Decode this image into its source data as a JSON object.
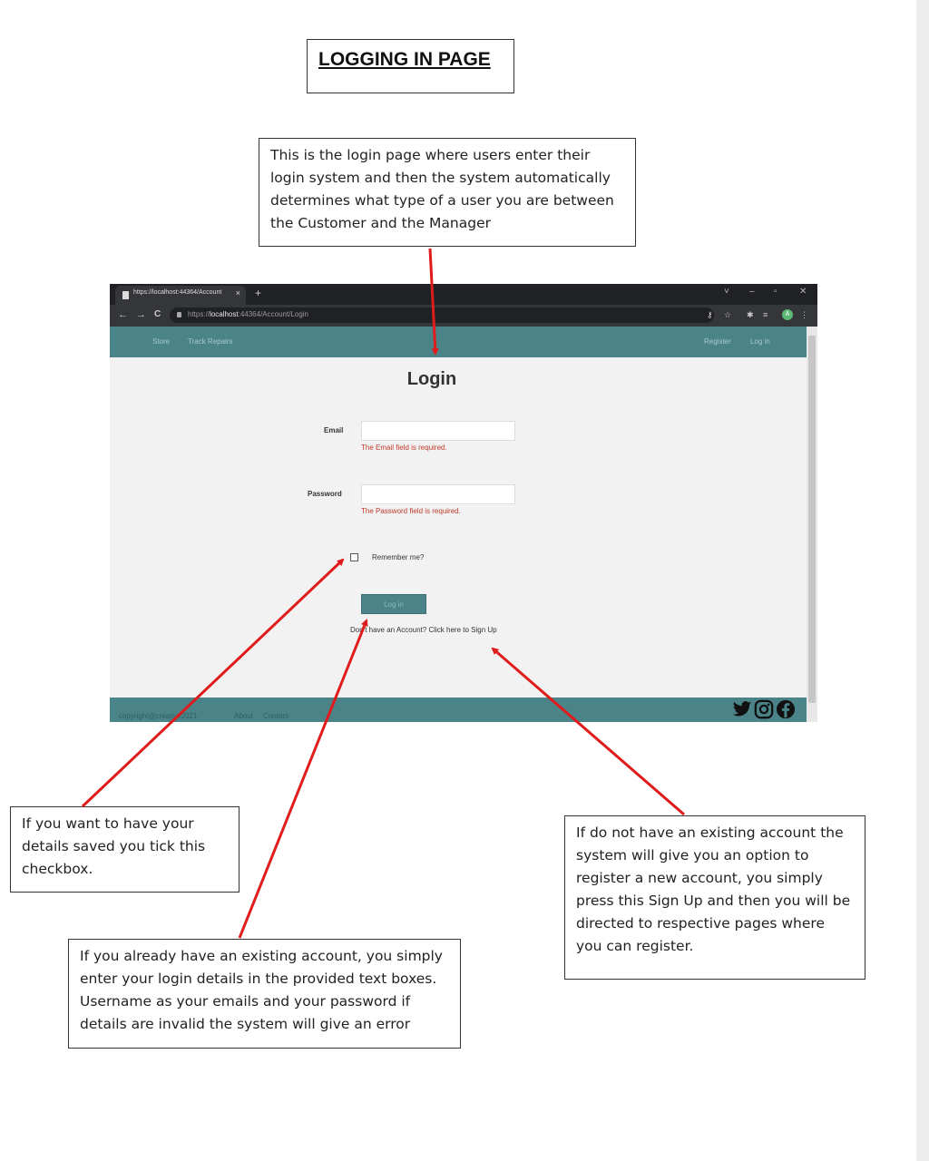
{
  "page": {
    "title": "LOGGING IN PAGE",
    "notes": {
      "login_intro": "This is the login page where users enter their login system and then the system automatically determines what type of a user you are between the Customer and the Manager",
      "checkbox": "If you want to have your details saved you tick this checkbox.",
      "existing_account": "If you already have an existing account, you simply enter your login details in the provided text boxes. Username as your emails and your password if details are invalid the system will give an error",
      "sign_up": "If do not have an existing account the system will give you an option to register a new account, you simply press this Sign Up and then you will be directed to respective pages where you can register."
    }
  },
  "browser": {
    "tab_title": "https://localhost:44364/Account",
    "new_tab": "+",
    "tab_close": "×",
    "url_prefix": "https://",
    "url_host": "localhost",
    "url_rest": ":44364/Account/Login",
    "window_controls": [
      "˅",
      "–",
      "▫",
      "✕"
    ],
    "nav": [
      "←",
      "→",
      "C"
    ],
    "toolbar_icons": [
      "key-icon",
      "star-icon",
      "puzzle-icon",
      "playlist-icon",
      "menu-icon"
    ],
    "avatar_letter": "A"
  },
  "app": {
    "nav_left": [
      "Store",
      "Track Repairs"
    ],
    "nav_right": [
      "Register",
      "Log in"
    ],
    "heading": "Login",
    "email_label": "Email",
    "email_error": "The Email field is required.",
    "password_label": "Password",
    "password_error": "The Password field is required.",
    "remember_label": "Remember me?",
    "login_button": "Log in",
    "signup_text": "Don't have an Account? Click here to Sign Up",
    "footer_copyright": "copyright@creative2021",
    "footer_links": [
      "About",
      "Contact"
    ],
    "social_icons": [
      "twitter-icon",
      "instagram-icon",
      "facebook-icon"
    ],
    "accent_color": "#4a8489",
    "error_color": "#c0392b"
  },
  "annotation_color": "#e01b1b"
}
